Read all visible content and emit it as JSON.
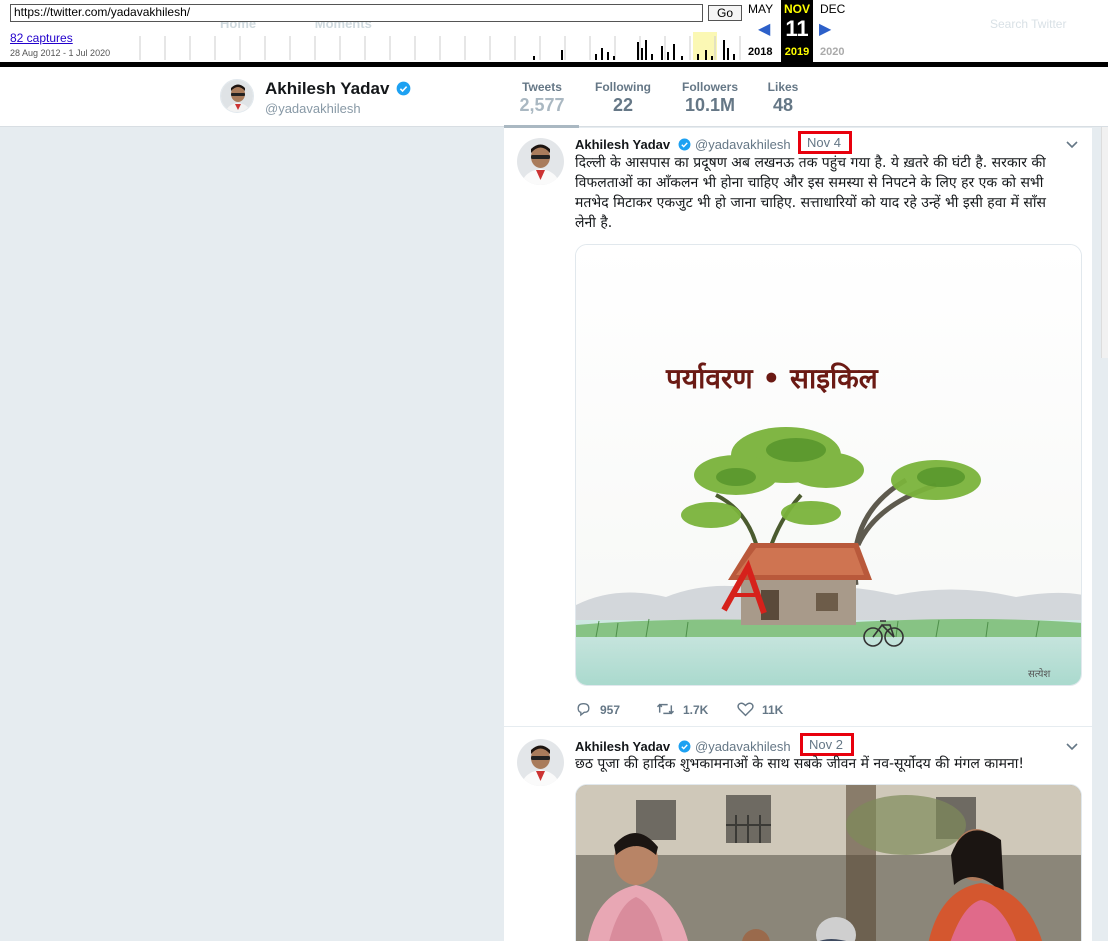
{
  "wayback": {
    "url": "https://twitter.com/yadavakhilesh/",
    "go_label": "Go",
    "captures_label": "82 captures",
    "date_range": "28 Aug 2012 - 1 Jul 2020",
    "prev_month": "MAY",
    "cur_month": "NOV",
    "cur_day": "11",
    "cur_year": "2019",
    "next_month": "DEC",
    "prev_year": "2018",
    "next_year": "2020"
  },
  "twitter_header": {
    "home_label": "Home",
    "moments_label": "Moments",
    "search_placeholder": "Search Twitter"
  },
  "profile": {
    "name": "Akhilesh Yadav",
    "handle": "@yadavakhilesh",
    "verified": true,
    "stats": [
      {
        "label": "Tweets",
        "value": "2,577"
      },
      {
        "label": "Following",
        "value": "22"
      },
      {
        "label": "Followers",
        "value": "10.1M"
      },
      {
        "label": "Likes",
        "value": "48"
      }
    ]
  },
  "tweets": [
    {
      "name": "Akhilesh Yadav",
      "handle": "@yadavakhilesh",
      "date": "Nov 4",
      "lines": [
        "दिल्ली के आसपास का प्रदूषण अब लखनऊ तक पहुंच गया है. ये ख़तरे की घंटी है. सरकार की",
        "विफलताओं का आँकलन भी होना चाहिए और इस समस्या से निपटने के लिए हर एक को सभी",
        "मतभेद मिटाकर एकजुट भी हो जाना चाहिए.   सत्ताधारियों को याद रहे उन्हें भी इसी हवा में साँस",
        "लेनी है."
      ],
      "media_caption": "पर्यावरण • साइकिल",
      "media_signature": "सत्येश",
      "replies": "957",
      "retweets": "1.7K",
      "likes": "11K"
    },
    {
      "name": "Akhilesh Yadav",
      "handle": "@yadavakhilesh",
      "date": "Nov 2",
      "lines": [
        "छठ पूजा की हार्दिक शुभकामनाओं के साथ सबके जीवन में नव-सूर्योदय की मंगल कामना!"
      ]
    }
  ],
  "colors": {
    "verified": "#1da1f2",
    "highlight_box": "#e8000d",
    "wayback_current": "#ffff00",
    "wayback_arrow": "#2d60c9"
  }
}
